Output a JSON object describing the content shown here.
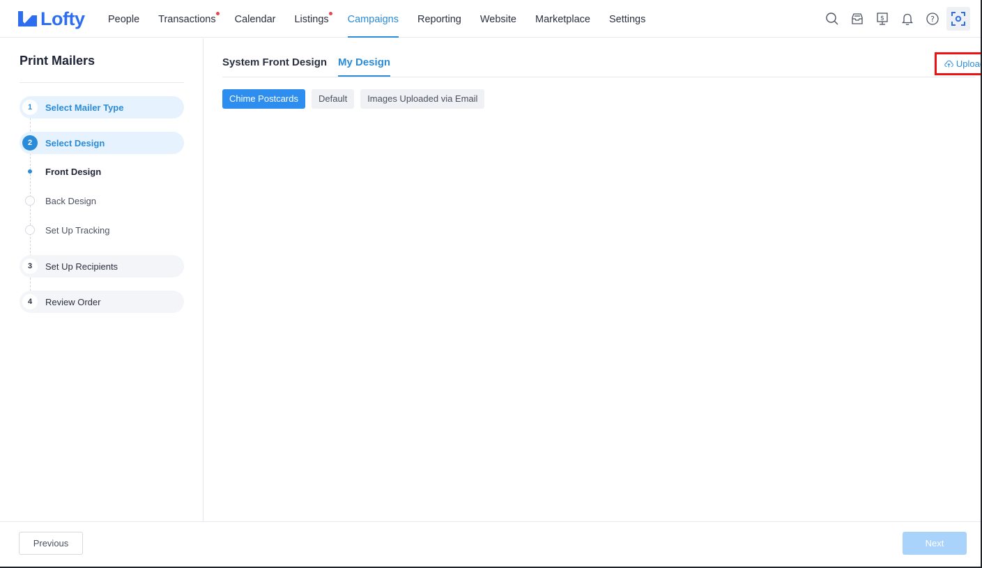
{
  "app": {
    "logo_text": "Lofty"
  },
  "nav": {
    "items": [
      {
        "label": "People",
        "dot": false,
        "active": false
      },
      {
        "label": "Transactions",
        "dot": true,
        "active": false
      },
      {
        "label": "Calendar",
        "dot": false,
        "active": false
      },
      {
        "label": "Listings",
        "dot": true,
        "active": false
      },
      {
        "label": "Campaigns",
        "dot": false,
        "active": true
      },
      {
        "label": "Reporting",
        "dot": false,
        "active": false
      },
      {
        "label": "Website",
        "dot": false,
        "active": false
      },
      {
        "label": "Marketplace",
        "dot": false,
        "active": false
      },
      {
        "label": "Settings",
        "dot": false,
        "active": false
      }
    ],
    "icons": [
      "search-icon",
      "inbox-icon",
      "billing-icon",
      "bell-icon",
      "help-icon",
      "screenshot-focus-icon"
    ],
    "accent_color": "#2a8bd8",
    "dot_color": "#e8454d"
  },
  "sidebar": {
    "title": "Print Mailers",
    "steps": [
      {
        "number": "1",
        "label": "Select Mailer Type",
        "state": "done"
      },
      {
        "number": "2",
        "label": "Select Design",
        "state": "current"
      },
      {
        "number": "3",
        "label": "Set Up Recipients",
        "state": "pending"
      },
      {
        "number": "4",
        "label": "Review Order",
        "state": "pending"
      }
    ],
    "substeps": [
      {
        "label": "Front Design",
        "active": true
      },
      {
        "label": "Back Design",
        "active": false
      },
      {
        "label": "Set Up Tracking",
        "active": false
      }
    ]
  },
  "main": {
    "tabs": [
      {
        "label": "System Front Design",
        "active": false
      },
      {
        "label": "My Design",
        "active": true
      }
    ],
    "upload_label": "Upload",
    "filters": [
      {
        "label": "Chime Postcards",
        "selected": true
      },
      {
        "label": "Default",
        "selected": false
      },
      {
        "label": "Images Uploaded via Email",
        "selected": false
      }
    ]
  },
  "footer": {
    "previous_label": "Previous",
    "next_label": "Next"
  }
}
